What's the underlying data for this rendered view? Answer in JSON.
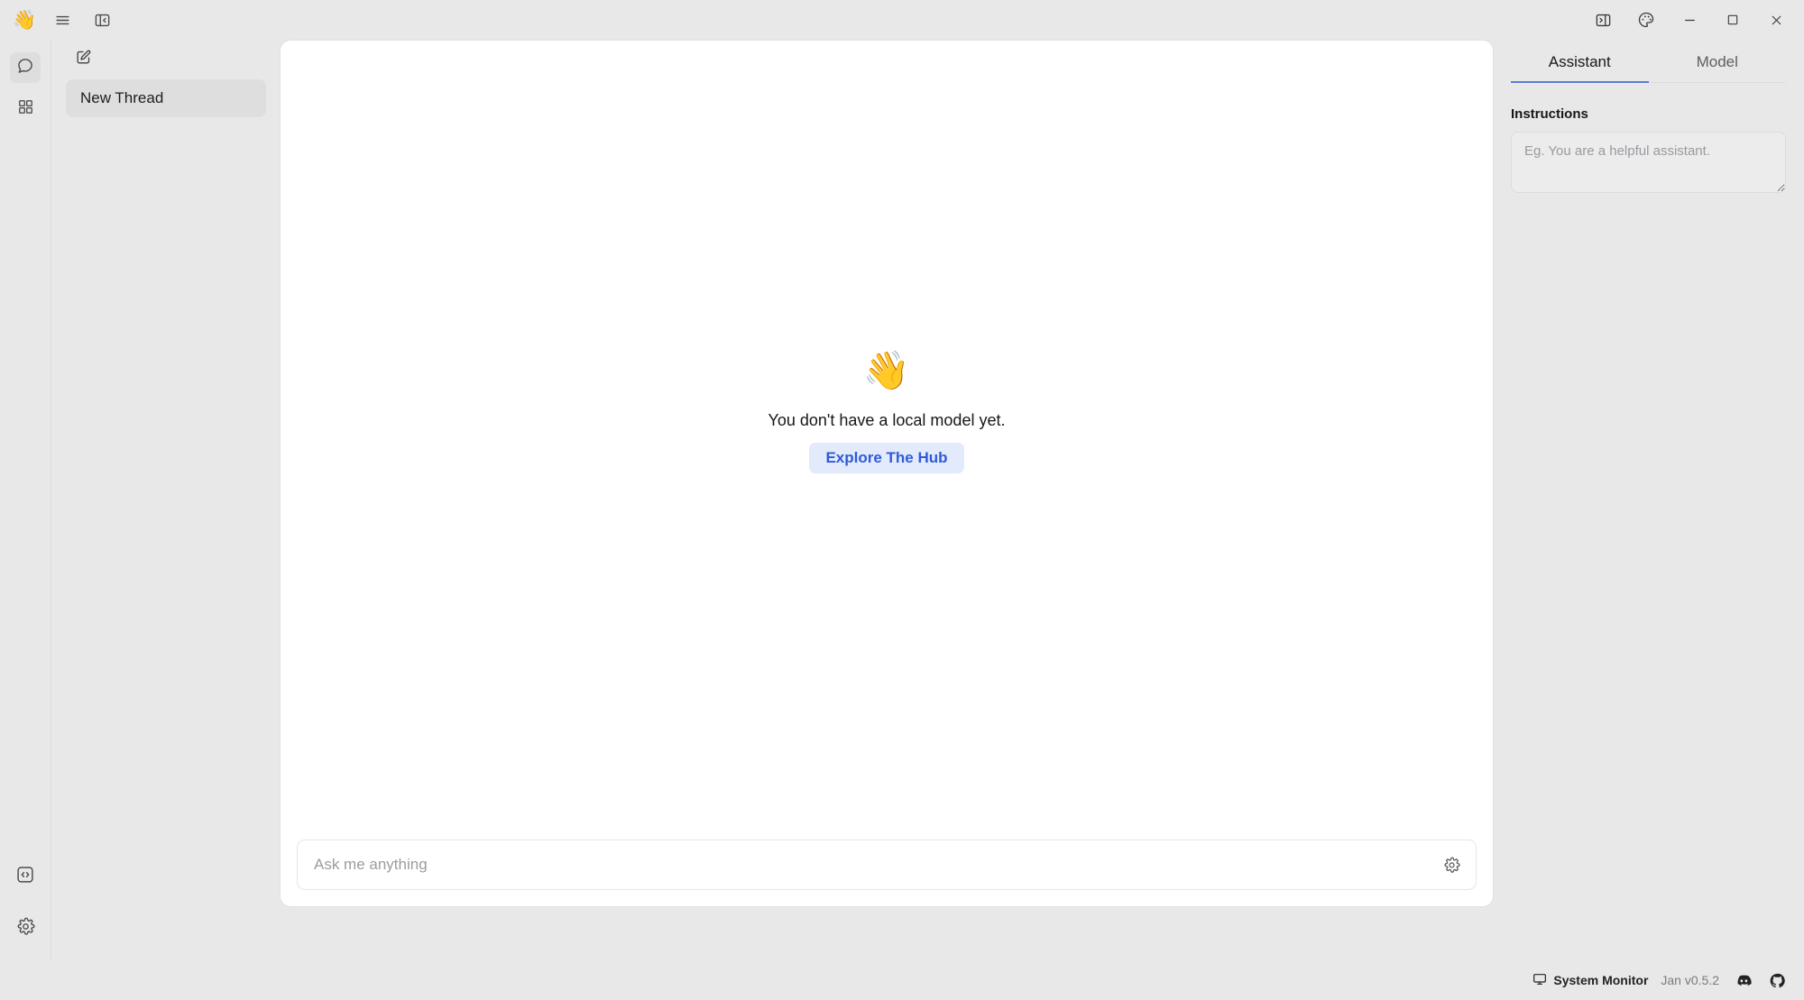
{
  "app": {
    "logo_emoji": "👋",
    "name": "Jan"
  },
  "titlebar": {
    "menu_label": "",
    "icons": {
      "hamburger": "hamburger-menu-icon",
      "panel_left": "panel-left-collapse-icon",
      "panel_right": "panel-right-toggle-icon",
      "theme": "palette-theme-icon",
      "minimize": "minimize-icon",
      "maximize": "maximize-icon",
      "close": "close-icon"
    }
  },
  "rail": {
    "items": [
      {
        "name": "chat",
        "icon": "chat-bubble-icon",
        "active": true
      },
      {
        "name": "hub",
        "icon": "grid-apps-icon",
        "active": false
      }
    ],
    "bottom_items": [
      {
        "name": "local-api-server",
        "icon": "code-brackets-icon"
      },
      {
        "name": "settings",
        "icon": "gear-icon"
      }
    ]
  },
  "threads": {
    "new_thread_icon": "pencil-square-icon",
    "items": [
      {
        "title": "New Thread",
        "selected": true
      }
    ]
  },
  "main": {
    "empty_state": {
      "emoji": "👋",
      "message": "You don't have a local model yet.",
      "cta_label": "Explore The Hub"
    },
    "composer": {
      "placeholder": "Ask me anything",
      "value": "",
      "settings_icon": "gear-icon"
    }
  },
  "right_panel": {
    "tabs": [
      {
        "label": "Assistant",
        "active": true
      },
      {
        "label": "Model",
        "active": false
      }
    ],
    "instructions": {
      "title": "Instructions",
      "placeholder": "Eg. You are a helpful assistant.",
      "value": ""
    }
  },
  "statusbar": {
    "system_monitor_label": "System Monitor",
    "version_label": "Jan v0.5.2",
    "discord_icon": "discord-icon",
    "github_icon": "github-icon"
  },
  "colors": {
    "accent_blue": "#5b7cda",
    "cta_text": "#2f5bd8",
    "cta_bg": "#e2eafb",
    "chrome_bg": "#e8e8e8",
    "card_bg": "#ffffff"
  }
}
